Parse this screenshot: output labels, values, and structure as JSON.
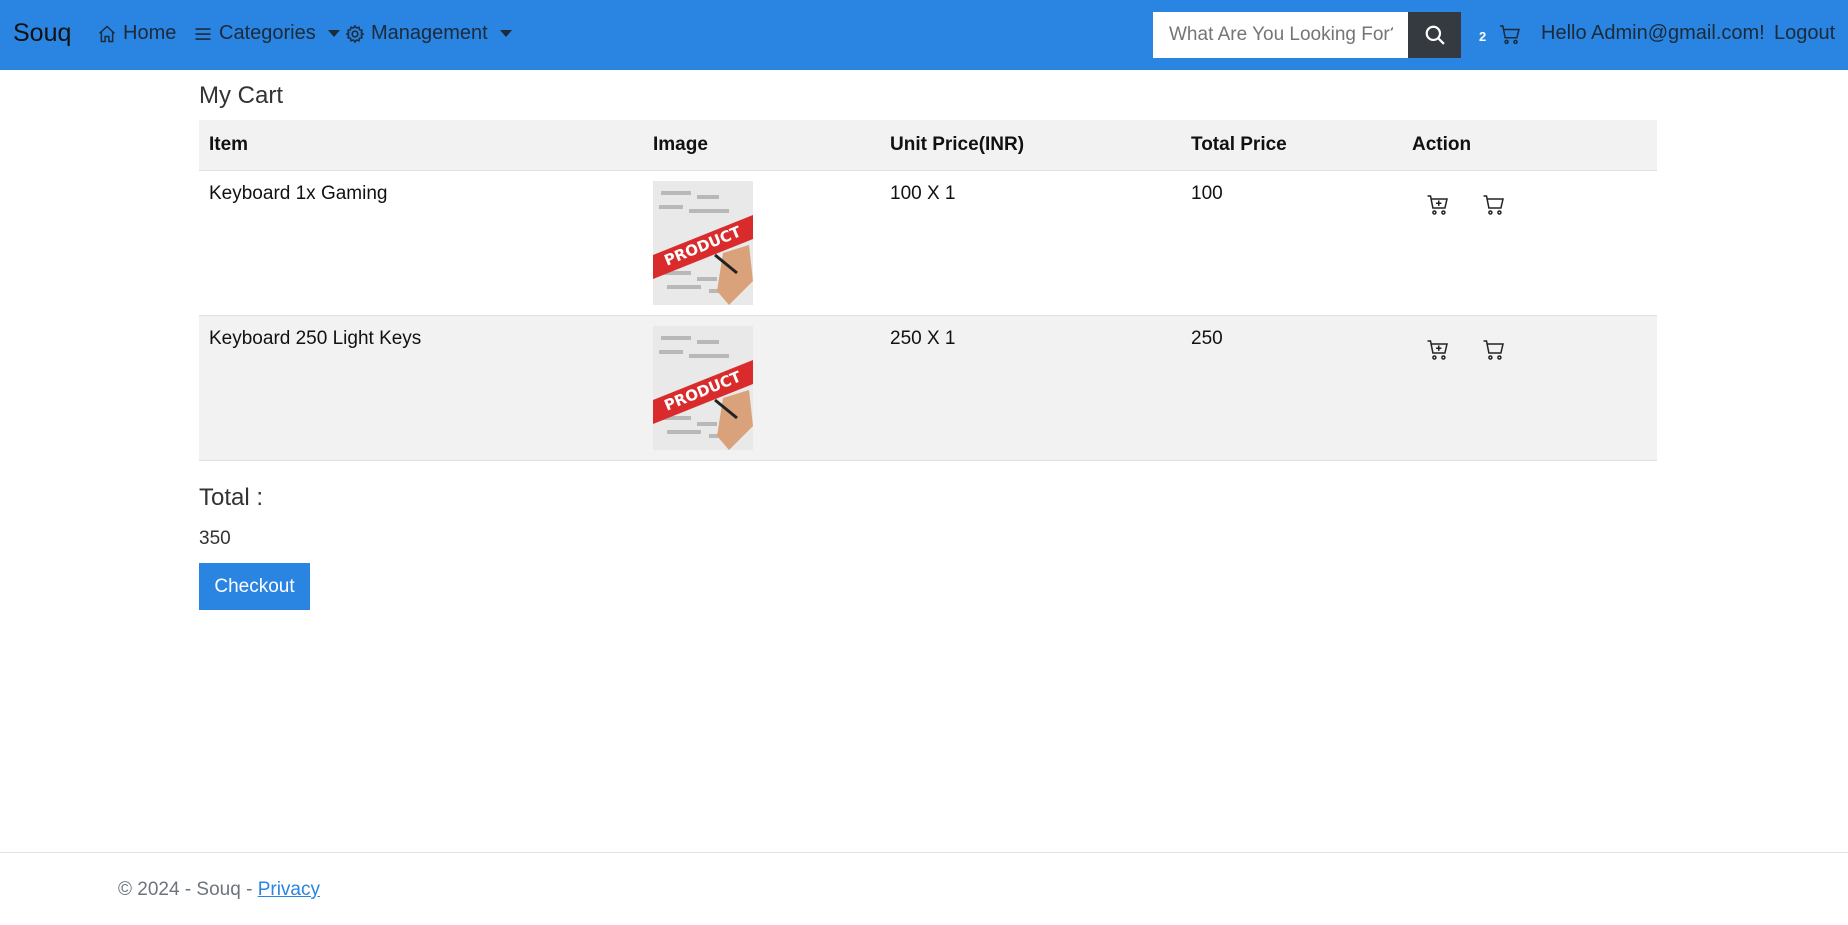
{
  "navbar": {
    "brand": "Souq",
    "home_label": "Home",
    "categories_label": "Categories",
    "management_label": "Management",
    "search_placeholder": "What Are You Looking For?",
    "cart_count": "2",
    "greeting": "Hello Admin@gmail.com!",
    "logout_label": "Logout"
  },
  "main": {
    "title": "My Cart",
    "columns": [
      "Item",
      "Image",
      "Unit Price(INR)",
      "Total Price",
      "Action"
    ],
    "rows": [
      {
        "item": "Keyboard 1x Gaming",
        "unit_price": "100 X 1",
        "total_price": "100"
      },
      {
        "item": "Keyboard 250 Light Keys",
        "unit_price": "250 X 1",
        "total_price": "250"
      }
    ],
    "total_label": "Total :",
    "total_value": "350",
    "checkout_label": "Checkout"
  },
  "footer": {
    "copyright": "© 2024 - Souq - ",
    "privacy_label": "Privacy"
  },
  "colors": {
    "primary": "#2a85e2",
    "dark_button": "#343a40",
    "row_alt": "#f2f2f2"
  }
}
